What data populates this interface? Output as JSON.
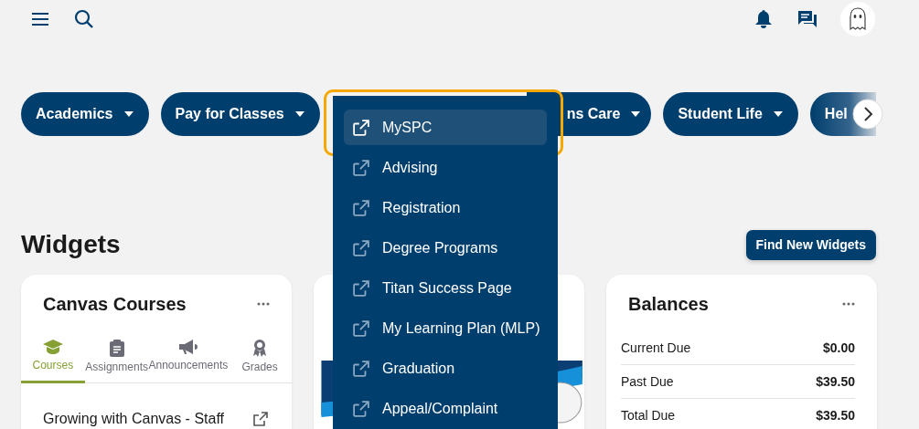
{
  "nav": [
    {
      "label": "Academics",
      "kind": "pill"
    },
    {
      "label": "Pay for Classes",
      "kind": "pill"
    },
    {
      "label": "ns Care",
      "kind": "covered"
    },
    {
      "label": "Student Life",
      "kind": "pill"
    },
    {
      "label": "Hel",
      "kind": "faded"
    }
  ],
  "dropdown": {
    "items": [
      {
        "label": "MySPC",
        "selected": true
      },
      {
        "label": "Advising",
        "selected": false
      },
      {
        "label": "Registration",
        "selected": false
      },
      {
        "label": "Degree Programs",
        "selected": false
      },
      {
        "label": "Titan Success Page",
        "selected": false
      },
      {
        "label": "My Learning Plan (MLP)",
        "selected": false
      },
      {
        "label": "Graduation",
        "selected": false
      },
      {
        "label": "Appeal/Complaint",
        "selected": false
      }
    ]
  },
  "widgets": {
    "title": "Widgets",
    "button": "Find New Widgets"
  },
  "canvas_card": {
    "title": "Canvas Courses",
    "tabs": [
      {
        "label": "Courses",
        "selected": true
      },
      {
        "label": "Assignments",
        "selected": false
      },
      {
        "label": "Announcements",
        "selected": false
      },
      {
        "label": "Grades",
        "selected": false
      }
    ],
    "courses": [
      "Growing with Canvas - Staff"
    ]
  },
  "balances": {
    "title": "Balances",
    "rows": [
      {
        "label": "Current Due",
        "amount": "$0.00"
      },
      {
        "label": "Past Due",
        "amount": "$39.50"
      },
      {
        "label": "Total Due",
        "amount": "$39.50"
      }
    ]
  }
}
